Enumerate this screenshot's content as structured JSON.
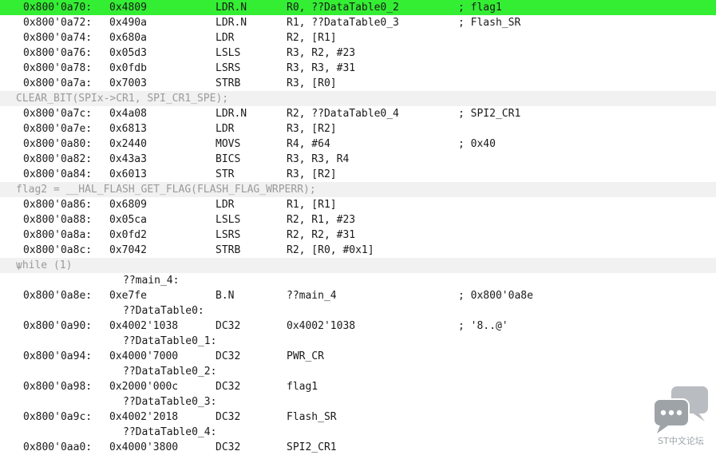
{
  "rows": [
    {
      "type": "inst",
      "highlight": true,
      "addr": "0x800'0a70:",
      "op": "0x4809",
      "mn": "LDR.N",
      "args": "R0, ??DataTable0_2",
      "cmt": "; flag1"
    },
    {
      "type": "inst",
      "addr": "0x800'0a72:",
      "op": "0x490a",
      "mn": "LDR.N",
      "args": "R1, ??DataTable0_3",
      "cmt": "; Flash_SR"
    },
    {
      "type": "inst",
      "addr": "0x800'0a74:",
      "op": "0x680a",
      "mn": "LDR",
      "args": "R2, [R1]",
      "cmt": ""
    },
    {
      "type": "inst",
      "addr": "0x800'0a76:",
      "op": "0x05d3",
      "mn": "LSLS",
      "args": "R3, R2, #23",
      "cmt": ""
    },
    {
      "type": "inst",
      "addr": "0x800'0a78:",
      "op": "0x0fdb",
      "mn": "LSRS",
      "args": "R3, R3, #31",
      "cmt": ""
    },
    {
      "type": "inst",
      "addr": "0x800'0a7a:",
      "op": "0x7003",
      "mn": "STRB",
      "args": "R3, [R0]",
      "cmt": ""
    },
    {
      "type": "src",
      "text": "CLEAR_BIT(SPIx->CR1, SPI_CR1_SPE);"
    },
    {
      "type": "inst",
      "addr": "0x800'0a7c:",
      "op": "0x4a08",
      "mn": "LDR.N",
      "args": "R2, ??DataTable0_4",
      "cmt": "; SPI2_CR1"
    },
    {
      "type": "inst",
      "addr": "0x800'0a7e:",
      "op": "0x6813",
      "mn": "LDR",
      "args": "R3, [R2]",
      "cmt": ""
    },
    {
      "type": "inst",
      "addr": "0x800'0a80:",
      "op": "0x2440",
      "mn": "MOVS",
      "args": "R4, #64",
      "cmt": "; 0x40"
    },
    {
      "type": "inst",
      "addr": "0x800'0a82:",
      "op": "0x43a3",
      "mn": "BICS",
      "args": "R3, R3, R4",
      "cmt": ""
    },
    {
      "type": "inst",
      "addr": "0x800'0a84:",
      "op": "0x6013",
      "mn": "STR",
      "args": "R3, [R2]",
      "cmt": ""
    },
    {
      "type": "src",
      "text": "flag2 = __HAL_FLASH_GET_FLAG(FLASH_FLAG_WRPERR);"
    },
    {
      "type": "inst",
      "addr": "0x800'0a86:",
      "op": "0x6809",
      "mn": "LDR",
      "args": "R1, [R1]",
      "cmt": ""
    },
    {
      "type": "inst",
      "addr": "0x800'0a88:",
      "op": "0x05ca",
      "mn": "LSLS",
      "args": "R2, R1, #23",
      "cmt": ""
    },
    {
      "type": "inst",
      "addr": "0x800'0a8a:",
      "op": "0x0fd2",
      "mn": "LSRS",
      "args": "R2, R2, #31",
      "cmt": ""
    },
    {
      "type": "inst",
      "addr": "0x800'0a8c:",
      "op": "0x7042",
      "mn": "STRB",
      "args": "R2, [R0, #0x1]",
      "cmt": ""
    },
    {
      "type": "src",
      "text": "while (1)",
      "semi": ";"
    },
    {
      "type": "label",
      "text": "??main_4:"
    },
    {
      "type": "inst",
      "addr": "0x800'0a8e:",
      "op": "0xe7fe",
      "mn": "B.N",
      "args": "??main_4",
      "cmt": "; 0x800'0a8e"
    },
    {
      "type": "label",
      "text": "??DataTable0:"
    },
    {
      "type": "inst",
      "addr": "0x800'0a90:",
      "op": "0x4002'1038",
      "mn": "DC32",
      "args": "0x4002'1038",
      "cmt": "; '8..@'"
    },
    {
      "type": "label",
      "text": "??DataTable0_1:"
    },
    {
      "type": "inst",
      "addr": "0x800'0a94:",
      "op": "0x4000'7000",
      "mn": "DC32",
      "args": "PWR_CR",
      "cmt": ""
    },
    {
      "type": "label",
      "text": "??DataTable0_2:"
    },
    {
      "type": "inst",
      "addr": "0x800'0a98:",
      "op": "0x2000'000c",
      "mn": "DC32",
      "args": "flag1",
      "cmt": ""
    },
    {
      "type": "label",
      "text": "??DataTable0_3:"
    },
    {
      "type": "inst",
      "addr": "0x800'0a9c:",
      "op": "0x4002'2018",
      "mn": "DC32",
      "args": "Flash_SR",
      "cmt": ""
    },
    {
      "type": "label",
      "text": "??DataTable0_4:"
    },
    {
      "type": "inst",
      "addr": "0x800'0aa0:",
      "op": "0x4000'3800",
      "mn": "DC32",
      "args": "SPI2_CR1",
      "cmt": ""
    }
  ],
  "watermark": {
    "icon": "chat-bubbles-icon",
    "text": "ST中文论坛"
  },
  "colors": {
    "highlight": "#33ee33",
    "source_line_bg": "#f1f1f1",
    "source_line_text": "#9a9a9a"
  }
}
